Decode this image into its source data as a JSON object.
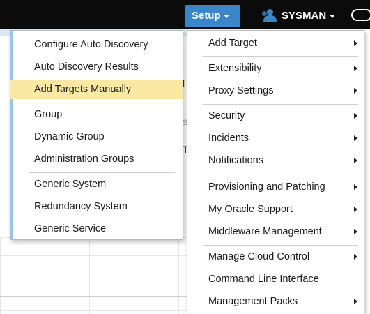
{
  "topbar": {
    "setup_label": "Setup",
    "user_label": "SYSMAN"
  },
  "icons": {
    "setup_caret": "chevron-down-icon",
    "user": "user-group-icon",
    "user_caret": "chevron-down-icon",
    "edge": "oval-icon",
    "submenu_arrow": "chevron-right-icon"
  },
  "colors": {
    "topbar_bg": "#0b0b0b",
    "setup_button_bg": "#3b86c9",
    "highlight_bg": "#fbe9a3",
    "menu_border": "#b9b9b9"
  },
  "background_fragments": [
    "l",
    "Sa",
    "T"
  ],
  "left_menu": {
    "items": [
      {
        "label": "Configure Auto Discovery",
        "highlighted": false
      },
      {
        "label": "Auto Discovery Results",
        "highlighted": false
      },
      {
        "label": "Add Targets Manually",
        "highlighted": true
      },
      {
        "label": "Group",
        "highlighted": false
      },
      {
        "label": "Dynamic Group",
        "highlighted": false
      },
      {
        "label": "Administration Groups",
        "highlighted": false
      },
      {
        "label": "Generic System",
        "highlighted": false
      },
      {
        "label": "Redundancy System",
        "highlighted": false
      },
      {
        "label": "Generic Service",
        "highlighted": false
      }
    ]
  },
  "right_menu": {
    "items": [
      {
        "label": "Add Target",
        "submenu": true
      },
      {
        "label": "Extensibility",
        "submenu": true
      },
      {
        "label": "Proxy Settings",
        "submenu": true
      },
      {
        "label": "Security",
        "submenu": true
      },
      {
        "label": "Incidents",
        "submenu": true
      },
      {
        "label": "Notifications",
        "submenu": true
      },
      {
        "label": "Provisioning and Patching",
        "submenu": true
      },
      {
        "label": "My Oracle Support",
        "submenu": true
      },
      {
        "label": "Middleware Management",
        "submenu": true
      },
      {
        "label": "Manage Cloud Control",
        "submenu": true
      },
      {
        "label": "Command Line Interface",
        "submenu": false
      },
      {
        "label": "Management Packs",
        "submenu": true
      }
    ]
  }
}
